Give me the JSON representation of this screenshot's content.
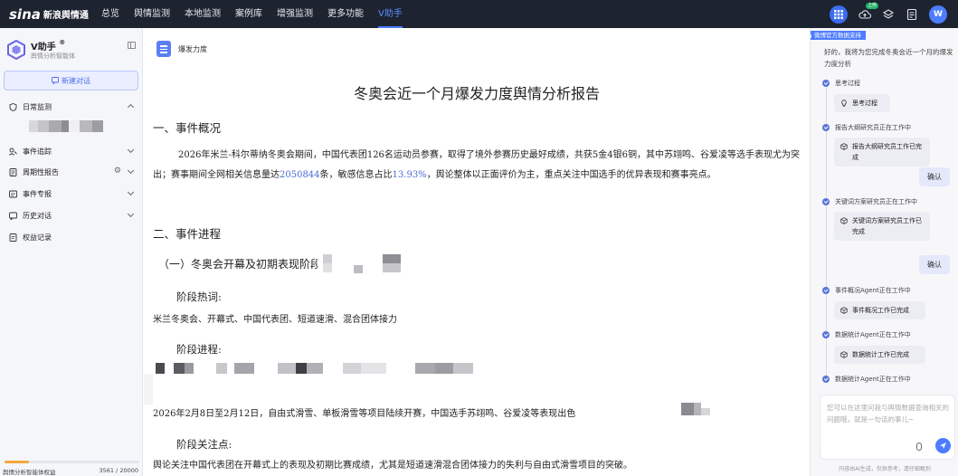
{
  "topnav": {
    "logo_text": "sina",
    "logo_sub": "新浪舆情通",
    "items": [
      {
        "label": "总览",
        "active": false
      },
      {
        "label": "舆情监测",
        "active": false
      },
      {
        "label": "本地监测",
        "active": false
      },
      {
        "label": "案例库",
        "active": false
      },
      {
        "label": "增强监测",
        "active": false
      },
      {
        "label": "更多功能",
        "active": false
      },
      {
        "label": "V助手",
        "active": true
      }
    ],
    "upload_badge": "上传",
    "avatar_letter": "W"
  },
  "sidebar": {
    "brand_name": "V助手",
    "brand_mark": "®",
    "brand_sub": "舆情分析智能体",
    "new_chat_label": "新建对话",
    "menu": [
      {
        "label": "日常监测",
        "icon": "shield-icon",
        "chevron": "up"
      },
      {
        "label": "事件追踪",
        "icon": "track-icon",
        "chevron": "down"
      },
      {
        "label": "周期性报告",
        "icon": "report-icon",
        "chevron": "down",
        "gear": true
      },
      {
        "label": "事件专报",
        "icon": "bulletin-icon",
        "chevron": "down"
      },
      {
        "label": "历史对话",
        "icon": "history-icon",
        "chevron": "down"
      },
      {
        "label": "权益记录",
        "icon": "record-icon",
        "chevron": ""
      }
    ],
    "quota_label": "舆情分析智能体权益",
    "quota_value": "3561 / 20000",
    "quota_fraction": 0.178
  },
  "doc": {
    "tab_title": "爆发力度",
    "report_title": "冬奥会近一个月爆发力度舆情分析报告",
    "section1_heading": "一、事件概况",
    "para1_a": "2026年米兰-科尔蒂纳冬奥会期间，中国代表团126名运动员参赛，取得了境外参赛历史最好成绩，共获5金4银6铜，其中苏翊鸣、谷爱凌等选手表现尤为突出；赛事期间全网相关信息量达",
    "para1_num1": "2050844",
    "para1_b": "条，敏感信息占比",
    "para1_num2": "13.93%",
    "para1_c": "，舆论整体以正面评价为主，重点关注中国选手的优异表现和赛事亮点。",
    "section2_heading": "二、事件进程",
    "sub1_heading": "（一）冬奥会开幕及初期表现阶段",
    "hotwords_label": "阶段热词:",
    "hotwords_text": "米兰冬奥会、开幕式、中国代表团、短道速滑、混合团体接力",
    "progress_label": "阶段进程:",
    "progress_text": "2026年2月8日至2月12日，自由式滑雪、单板滑雪等项目陆续开赛，中国选手苏翊鸣、谷爱凌等表现出色",
    "focus_label": "阶段关注点:",
    "focus_text": "舆论关注中国代表团在开幕式上的表现及初期比赛成绩，尤其是短道速滑混合团体接力的失利与自由式滑雪项目的突破。"
  },
  "assistant": {
    "support_tag": "微博官方数据支持",
    "intro": "好的，我将为您完成冬奥会近一个月的爆发力度分析",
    "steps": [
      {
        "text": "思考过程",
        "card": "思考过程"
      },
      {
        "text": "报告大纲研究员正在工作中",
        "card": "报告大纲研究员工作已完成"
      },
      {
        "text": "关键词方案研究员正在工作中",
        "card": "关键词方案研究员工作已完成"
      },
      {
        "text": "事件概况Agent正在工作中",
        "card": "事件概况工作已完成"
      },
      {
        "text": "数据统计Agent正在工作中",
        "card": "数据统计工作已完成"
      },
      {
        "text": "数据统计Agent正在工作中",
        "card": ""
      }
    ],
    "confirm_label": "确认",
    "input_placeholder": "您可以在这里问我与舆情数据查询相关的问题哦，就是一句话的事儿~",
    "disclaimer": "内容由AI生成，仅供参考，请仔细甄别"
  },
  "colors": {
    "nav_bg": "#1e2330",
    "accent": "#4d7cff",
    "highlight": "#4b6cd6",
    "quota_fill": "#f2a93b"
  }
}
